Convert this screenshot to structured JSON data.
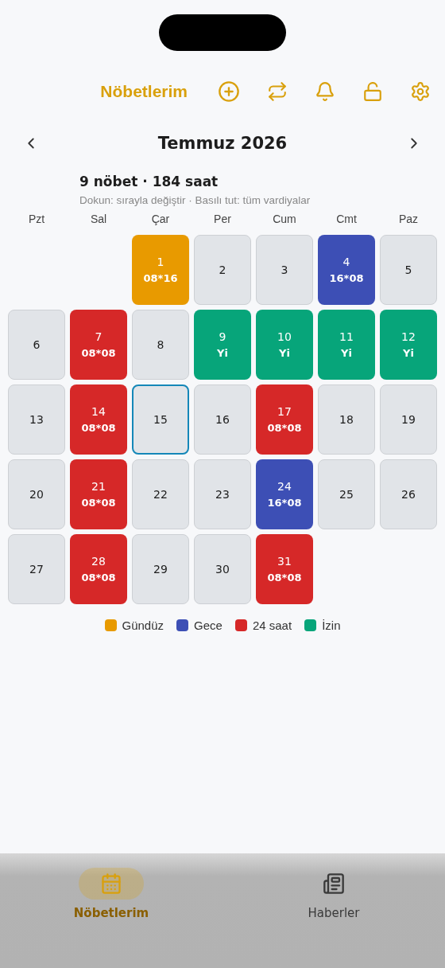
{
  "header": {
    "title": "Nöbetlerim"
  },
  "calendar": {
    "month": "Temmuz 2026",
    "summary": "9 nöbet · 184 saat",
    "hint": "Dokun: sırayla değiştir · Basılı tut: tüm vardiyalar",
    "weekdays": [
      "Pzt",
      "Sal",
      "Çar",
      "Per",
      "Cum",
      "Cmt",
      "Paz"
    ],
    "weeks": [
      [
        {
          "day": "1",
          "shift": "08*16",
          "kind": "day",
          "selected": false
        },
        {
          "day": "2",
          "kind": "none",
          "selected": false
        },
        {
          "day": "3",
          "kind": "none",
          "selected": false
        },
        {
          "day": "4",
          "shift": "16*08",
          "kind": "night",
          "selected": false
        },
        {
          "day": "5",
          "kind": "none",
          "selected": false
        }
      ],
      [
        {
          "day": "6",
          "kind": "none",
          "selected": false
        },
        {
          "day": "7",
          "shift": "08*08",
          "kind": "full",
          "selected": false
        },
        {
          "day": "8",
          "kind": "none",
          "selected": false
        },
        {
          "day": "9",
          "shift": "Yi",
          "kind": "leave",
          "selected": false
        },
        {
          "day": "10",
          "shift": "Yi",
          "kind": "leave",
          "selected": false
        },
        {
          "day": "11",
          "shift": "Yi",
          "kind": "leave",
          "selected": false
        },
        {
          "day": "12",
          "shift": "Yi",
          "kind": "leave",
          "selected": false
        }
      ],
      [
        {
          "day": "13",
          "kind": "none",
          "selected": false
        },
        {
          "day": "14",
          "shift": "08*08",
          "kind": "full",
          "selected": false
        },
        {
          "day": "15",
          "kind": "none",
          "selected": true
        },
        {
          "day": "16",
          "kind": "none",
          "selected": false
        },
        {
          "day": "17",
          "shift": "08*08",
          "kind": "full",
          "selected": false
        },
        {
          "day": "18",
          "kind": "none",
          "selected": false
        },
        {
          "day": "19",
          "kind": "none",
          "selected": false
        }
      ],
      [
        {
          "day": "20",
          "kind": "none",
          "selected": false
        },
        {
          "day": "21",
          "shift": "08*08",
          "kind": "full",
          "selected": false
        },
        {
          "day": "22",
          "kind": "none",
          "selected": false
        },
        {
          "day": "23",
          "kind": "none",
          "selected": false
        },
        {
          "day": "24",
          "shift": "16*08",
          "kind": "night",
          "selected": false
        },
        {
          "day": "25",
          "kind": "none",
          "selected": false
        },
        {
          "day": "26",
          "kind": "none",
          "selected": false
        }
      ],
      [
        {
          "day": "27",
          "kind": "none",
          "selected": false
        },
        {
          "day": "28",
          "shift": "08*08",
          "kind": "full",
          "selected": false
        },
        {
          "day": "29",
          "kind": "none",
          "selected": false
        },
        {
          "day": "30",
          "kind": "none",
          "selected": false
        },
        {
          "day": "31",
          "shift": "08*08",
          "kind": "full",
          "selected": false
        }
      ]
    ],
    "legend": [
      {
        "kind": "day",
        "label": "Gündüz",
        "color": "#e89a00"
      },
      {
        "kind": "night",
        "label": "Gece",
        "color": "#3d4fb5"
      },
      {
        "kind": "full",
        "label": "24 saat",
        "color": "#d62828"
      },
      {
        "kind": "leave",
        "label": "İzin",
        "color": "#07a57a"
      }
    ]
  },
  "bottom_nav": [
    {
      "label": "Nöbetlerim",
      "kind": "calendar",
      "selected": true
    },
    {
      "label": "Haberler",
      "kind": "news",
      "selected": false
    }
  ]
}
